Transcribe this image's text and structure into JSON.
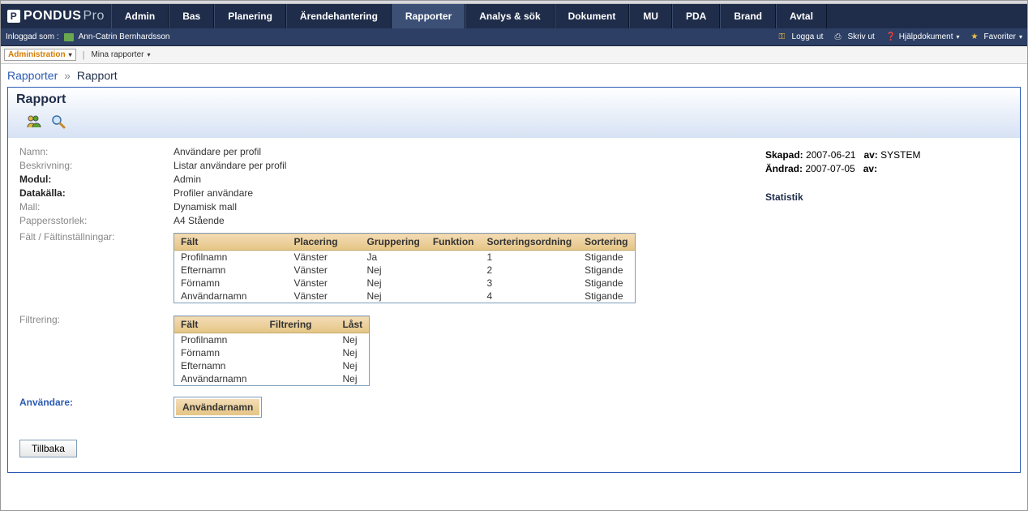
{
  "logo": {
    "text": "PONDUS",
    "suffix": "Pro"
  },
  "nav": [
    "Admin",
    "Bas",
    "Planering",
    "Ärendehantering",
    "Rapporter",
    "Analys & sök",
    "Dokument",
    "MU",
    "PDA",
    "Brand",
    "Avtal"
  ],
  "nav_active_index": 4,
  "userbar": {
    "logged_in_label": "Inloggad som :",
    "username": "Ann-Catrin Bernhardsson",
    "logout": "Logga ut",
    "print": "Skriv ut",
    "help": "Hjälpdokument",
    "favorites": "Favoriter"
  },
  "subnav": {
    "admin": "Administration",
    "myreports": "Mina rapporter"
  },
  "breadcrumb": {
    "parent": "Rapporter",
    "sep": "»",
    "current": "Rapport"
  },
  "panel_title": "Rapport",
  "meta": {
    "labels": {
      "name": "Namn:",
      "desc": "Beskrivning:",
      "module": "Modul:",
      "datasource": "Datakälla:",
      "template": "Mall:",
      "papersize": "Pappersstorlek:",
      "fields": "Fält",
      "fieldsettings": "Fältinställningar:",
      "filtering": "Filtrering:",
      "users": "Användare:"
    },
    "values": {
      "name": "Användare per profil",
      "desc": "Listar användare per profil",
      "module": "Admin",
      "datasource": "Profiler användare",
      "template": "Dynamisk mall",
      "papersize": "A4 Stående"
    }
  },
  "right": {
    "created_label": "Skapad:",
    "created_date": "2007-06-21",
    "by_label1": "av:",
    "created_by": "SYSTEM",
    "changed_label": "Ändrad:",
    "changed_date": "2007-07-05",
    "by_label2": "av:",
    "changed_by": "",
    "statistik": "Statistik"
  },
  "fields_table": {
    "headers": [
      "Fält",
      "Placering",
      "Gruppering",
      "Funktion",
      "Sorteringsordning",
      "Sortering"
    ],
    "rows": [
      [
        "Profilnamn",
        "Vänster",
        "Ja",
        "",
        "1",
        "Stigande"
      ],
      [
        "Efternamn",
        "Vänster",
        "Nej",
        "",
        "2",
        "Stigande"
      ],
      [
        "Förnamn",
        "Vänster",
        "Nej",
        "",
        "3",
        "Stigande"
      ],
      [
        "Användarnamn",
        "Vänster",
        "Nej",
        "",
        "4",
        "Stigande"
      ]
    ]
  },
  "filter_table": {
    "headers": [
      "Fält",
      "Filtrering",
      "Låst"
    ],
    "rows": [
      [
        "Profilnamn",
        "",
        "Nej"
      ],
      [
        "Förnamn",
        "",
        "Nej"
      ],
      [
        "Efternamn",
        "",
        "Nej"
      ],
      [
        "Användarnamn",
        "",
        "Nej"
      ]
    ]
  },
  "users_table": {
    "header": "Användarnamn"
  },
  "back": "Tillbaka"
}
